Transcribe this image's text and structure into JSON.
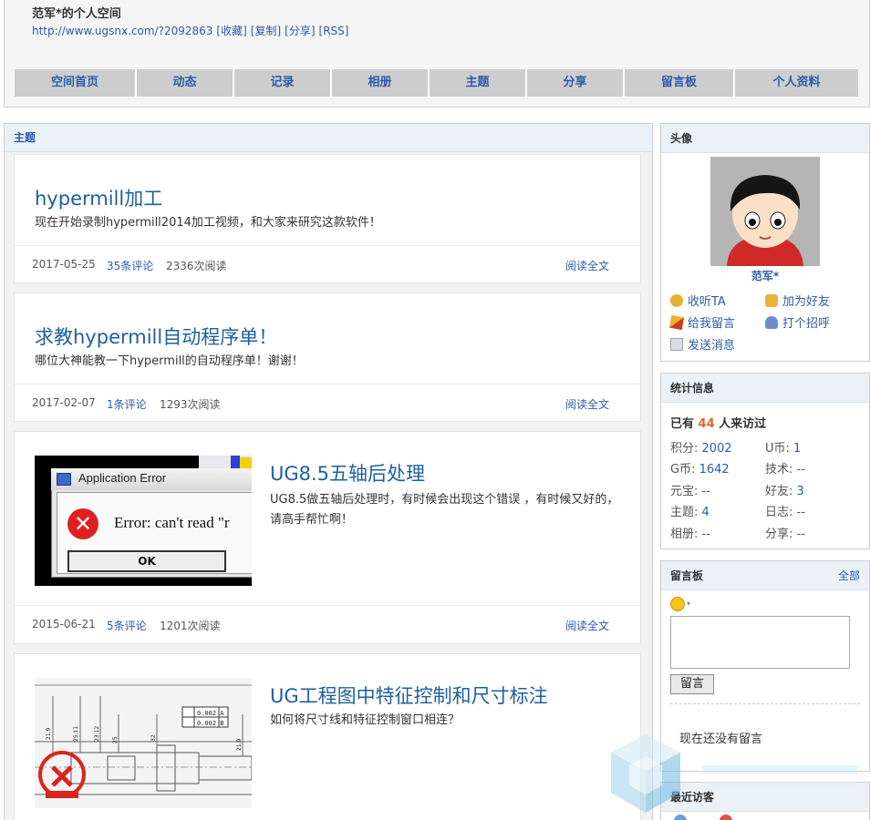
{
  "header": {
    "title": "范军*的个人空间",
    "url": "http://www.ugsnx.com/?2092863",
    "links": [
      "[收藏]",
      "[复制]",
      "[分享]",
      "[RSS]"
    ]
  },
  "nav": [
    "空间首页",
    "动态",
    "记录",
    "相册",
    "主题",
    "分享",
    "留言板",
    "个人资料"
  ],
  "main": {
    "heading": "主题",
    "read_all_label": "阅读全文",
    "posts": [
      {
        "title": "hypermill加工",
        "summary": "现在开始录制hypermill2014加工视频，和大家来研究这款软件！",
        "date": "2017-05-25",
        "comments": "35条评论",
        "views": "2336次阅读"
      },
      {
        "title": "求教hypermill自动程序单！",
        "summary": "哪位大神能教一下hypermill的自动程序单！谢谢！",
        "date": "2017-02-07",
        "comments": "1条评论",
        "views": "1293次阅读"
      },
      {
        "title": "UG8.5五轴后处理",
        "summary": "UG8.5做五轴后处理时，有时候会出现这个错误 ，有时候又好的，请高手帮忙啊！",
        "date": "2015-06-21",
        "comments": "5条评论",
        "views": "1201次阅读",
        "thumb": {
          "window_title": "Application Error",
          "error_text": "Error: can't read \"r",
          "ok_label": "OK"
        }
      },
      {
        "title": "UG工程图中特征控制和尺寸标注",
        "summary": "如何将尺寸线和特征控制窗口相连？",
        "thumb": {
          "tol1": "0.002 A",
          "tol2": "0.002 B",
          "dims": [
            "21.9",
            "25.11",
            "23.12",
            "25",
            "32",
            "21.9"
          ]
        }
      }
    ]
  },
  "sidebar": {
    "avatar": {
      "heading": "头像",
      "name": "范军*",
      "actions": [
        "收听TA",
        "加为好友",
        "给我留言",
        "打个招呼",
        "发送消息"
      ]
    },
    "stats": {
      "heading": "统计信息",
      "visit_prefix": "已有",
      "visit_count": "44",
      "visit_suffix": "人来访过",
      "rows": [
        {
          "label": "积分:",
          "value": "2002"
        },
        {
          "label": "U币:",
          "value": "1"
        },
        {
          "label": "G币:",
          "value": "1642"
        },
        {
          "label": "技术:",
          "value": "--"
        },
        {
          "label": "元宝:",
          "value": "--"
        },
        {
          "label": "好友:",
          "value": "3"
        },
        {
          "label": "主题:",
          "value": "4"
        },
        {
          "label": "日志:",
          "value": "--"
        },
        {
          "label": "相册:",
          "value": "--"
        },
        {
          "label": "分享:",
          "value": "--"
        }
      ]
    },
    "guestbook": {
      "heading": "留言板",
      "more": "全部",
      "button": "留言",
      "empty": "现在还没有留言"
    },
    "recent_visitors": {
      "heading": "最近访客"
    }
  },
  "colors": {
    "link": "#2a5caa",
    "accent": "#e0632c",
    "title": "#1f5f9c"
  }
}
